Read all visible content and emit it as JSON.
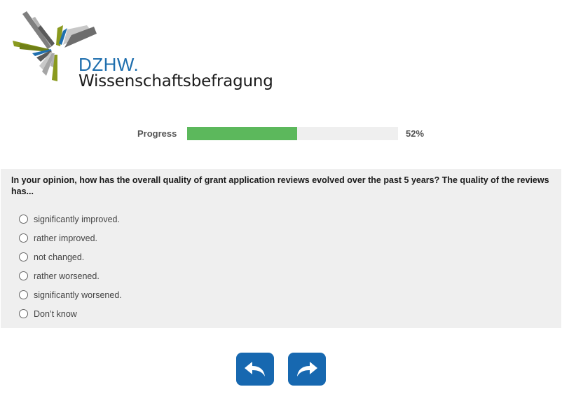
{
  "logo": {
    "acronym": "DZHW.",
    "name": "Wissenschaftsbefragung"
  },
  "progress": {
    "label": "Progress",
    "percent_text": "52%",
    "value": 0.52,
    "fill_color": "#5cb85c"
  },
  "question": {
    "text": "In your opinion, how has the overall quality of grant application reviews evolved over the past 5 years? The quality of the reviews has...",
    "options": [
      "significantly improved.",
      "rather improved.",
      "not changed.",
      "rather worsened.",
      "significantly worsened.",
      "Don’t know"
    ],
    "selected": null
  },
  "navigation": {
    "back_icon": "undo-arrow-icon",
    "next_icon": "redo-arrow-icon",
    "button_color": "#1768b0"
  }
}
